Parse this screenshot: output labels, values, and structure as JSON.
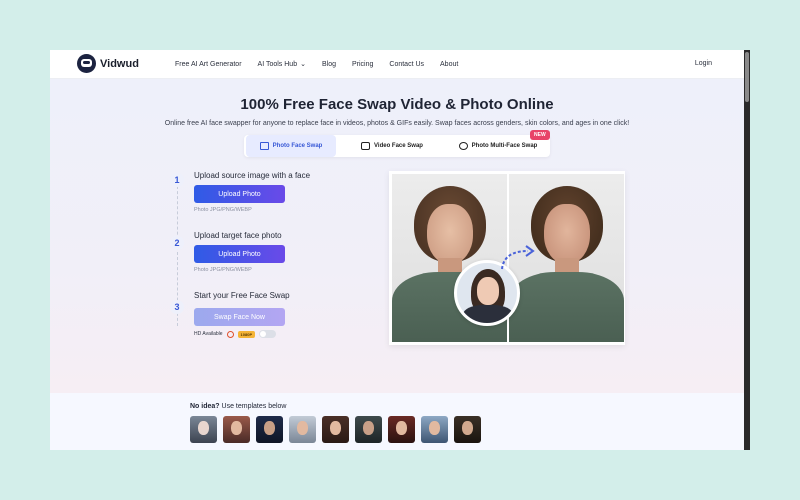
{
  "brand": {
    "name": "Vidwud"
  },
  "nav": {
    "links": [
      "Free AI Art Generator",
      "AI Tools Hub",
      "Blog",
      "Pricing",
      "Contact Us",
      "About"
    ],
    "login": "Login"
  },
  "hero": {
    "title": "100% Free Face Swap Video & Photo Online",
    "subtitle": "Online free AI face swapper for anyone to replace face in videos, photos & GIFs easily. Swap faces across genders, skin colors, and ages in one click!"
  },
  "tabs": [
    {
      "label": "Photo Face Swap",
      "active": true
    },
    {
      "label": "Video Face Swap",
      "active": false
    },
    {
      "label": "Photo Multi-Face Swap",
      "active": false,
      "badge": "NEW"
    }
  ],
  "steps": [
    {
      "num": "1",
      "title": "Upload source image with a face",
      "button": "Upload Photo",
      "formats": "Photo JPG/PNG/WEBP"
    },
    {
      "num": "2",
      "title": "Upload target face photo",
      "button": "Upload Photo",
      "formats": "Photo JPG/PNG/WEBP"
    },
    {
      "num": "3",
      "title": "Start your Free Face Swap",
      "button": "Swap Face Now"
    }
  ],
  "hd": {
    "label": "HD Available",
    "badge": "1080P",
    "enabled": false
  },
  "templates": {
    "label_bold": "No idea?",
    "label_rest": " Use templates below",
    "count": 9
  },
  "colors": {
    "primary": "#3858d6",
    "gradient_start": "#2f5be6",
    "gradient_end": "#6a4ae8",
    "badge_new": "#e84468"
  }
}
